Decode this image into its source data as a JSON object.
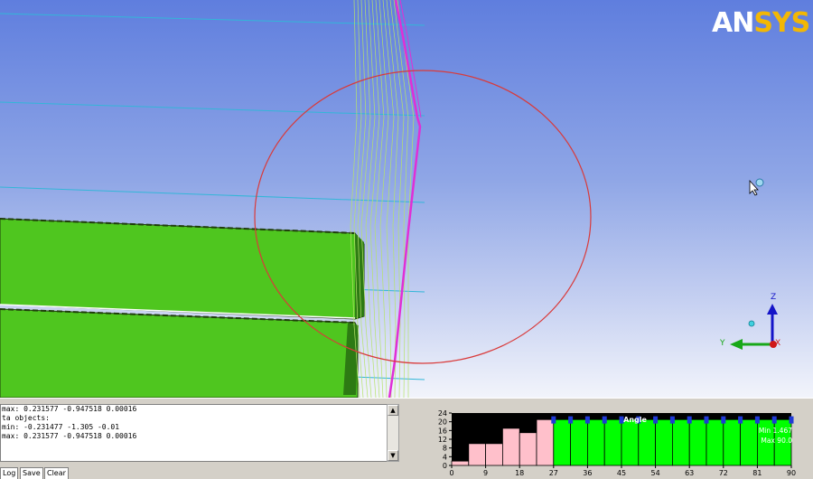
{
  "logo": {
    "part1": "AN",
    "part2": "SYS"
  },
  "console": {
    "lines": [
      "max: 0.231577 -0.947518 0.00016",
      "ta objects:",
      "min: -0.231477 -1.305 -0.01",
      "max: 0.231577 -0.947518 0.00016"
    ]
  },
  "tabs": [
    {
      "label": "Log"
    },
    {
      "label": "Save"
    },
    {
      "label": "Clear"
    }
  ],
  "axes": {
    "z": "Z",
    "y": "Y",
    "x": "X"
  },
  "chart_data": {
    "type": "bar",
    "title": "Angle",
    "y_ticks": [
      "0",
      "4",
      "8",
      "12",
      "16",
      "20",
      "24"
    ],
    "ylim": [
      0,
      24
    ],
    "x_ticks": [
      "0",
      "9",
      "18",
      "27",
      "36",
      "45",
      "54",
      "63",
      "72",
      "81",
      "90"
    ],
    "xlim": [
      0,
      90
    ],
    "bin_width": 4.5,
    "bins": [
      2,
      10,
      10,
      17,
      15,
      21,
      21,
      21,
      21,
      21,
      21,
      21,
      21,
      21,
      21,
      21,
      21,
      21,
      21,
      21
    ],
    "bad_color": "#ffc0cb",
    "good_color": "#00ff00",
    "marker_color": "#1f3ad6",
    "background": "#000000",
    "min_label": "Min 1.467",
    "max_label": "Max 90.0"
  }
}
